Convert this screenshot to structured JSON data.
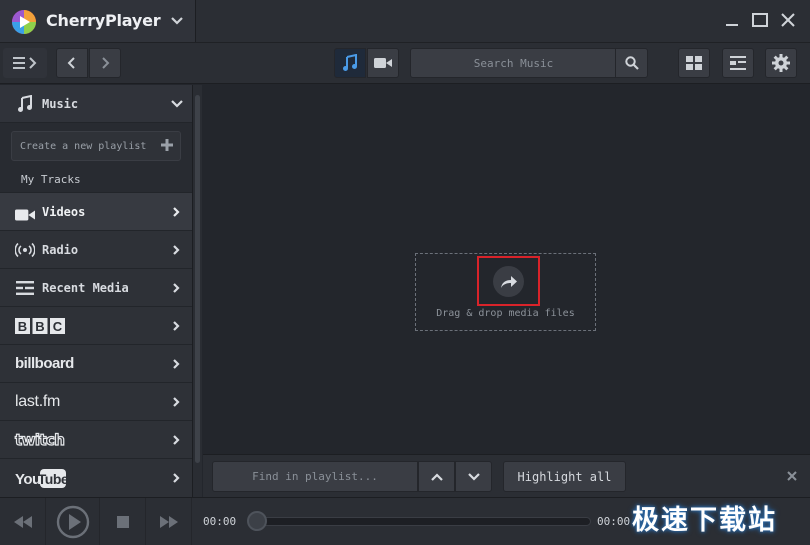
{
  "app": {
    "title": "CherryPlayer"
  },
  "toolbar": {
    "search_placeholder": "Search Music",
    "icons": [
      "menu-icon",
      "chevron-left-icon",
      "chevron-right-icon",
      "music-note-icon",
      "video-camera-icon",
      "search-icon",
      "grid-view-icon",
      "list-view-icon",
      "gear-icon"
    ]
  },
  "sidebar": {
    "music_label": "Music",
    "new_playlist_placeholder": "Create a new playlist",
    "my_tracks_label": "My Tracks",
    "items": [
      {
        "label": "Videos",
        "icon": "video-camera-icon"
      },
      {
        "label": "Radio",
        "icon": "radio-waves-icon"
      },
      {
        "label": "Recent Media",
        "icon": "recent-media-icon"
      }
    ],
    "brands": [
      "BBC",
      "billboard",
      "last.fm",
      "twitch",
      "YouTube"
    ]
  },
  "main": {
    "drop_text": "Drag & drop media files"
  },
  "findbar": {
    "placeholder": "Find in playlist...",
    "highlight_label": "Highlight all"
  },
  "player": {
    "time_current": "00:00",
    "time_total": "00:00",
    "progress": 0
  },
  "watermark": {
    "text": "极速下载站"
  },
  "colors": {
    "background": "#23262c",
    "panel": "#2b2e34",
    "accent_blue": "#4a9be8",
    "highlight_red": "#d9232a"
  }
}
